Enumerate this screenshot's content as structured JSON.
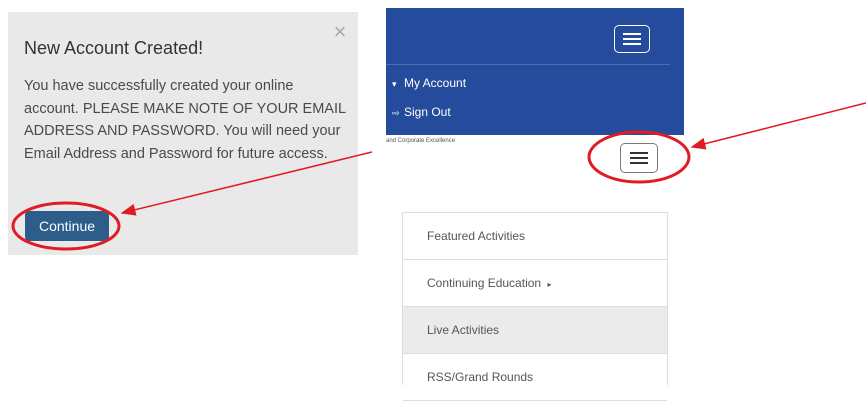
{
  "dialog": {
    "title": "New Account Created!",
    "message": "You have successfully created your online account. PLEASE MAKE NOTE OF YOUR EMAIL ADDRESS AND PASSWORD. You will need your Email Address and Password for future access.",
    "close_symbol": "×",
    "continue_label": "Continue",
    "colors": {
      "background": "#e9e9e9",
      "button": "#2d5d8a"
    }
  },
  "topnav": {
    "background": "#244b9c",
    "toggle_icon": "hamburger-icon",
    "items": [
      {
        "icon": "caret-down-icon",
        "symbol": "▾",
        "label": "My Account"
      },
      {
        "icon": "sign-out-icon",
        "symbol": "⇨",
        "label": "Sign Out"
      }
    ],
    "subline": "and Corporate Excellence"
  },
  "menu": {
    "toggle_icon": "hamburger-icon",
    "items": [
      {
        "label": "Featured Activities",
        "active": false
      },
      {
        "label": "Continuing Education",
        "submenu_symbol": "▸",
        "active": false
      },
      {
        "label": "Live Activities",
        "active": true
      },
      {
        "label": "RSS/Grand Rounds",
        "active": false
      }
    ]
  },
  "annotations": {
    "color": "#e01b24"
  }
}
